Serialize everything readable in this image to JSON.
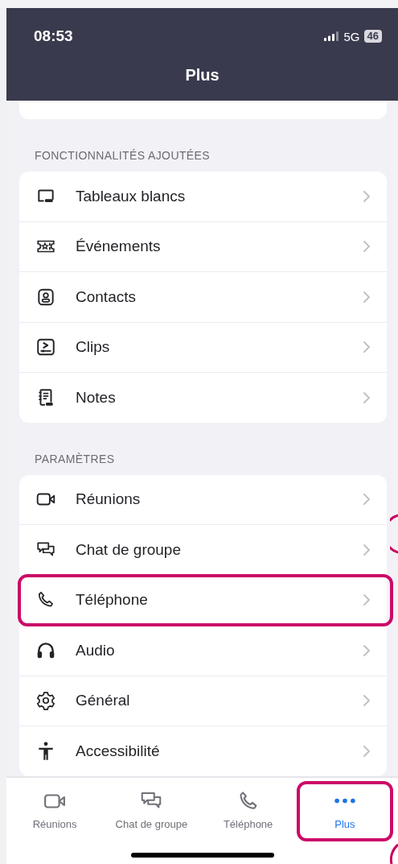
{
  "status_bar": {
    "time": "08:53",
    "network": "5G",
    "battery": "46"
  },
  "header": {
    "title": "Plus"
  },
  "sections": [
    {
      "title": "FONCTIONNALITÉS AJOUTÉES",
      "items": [
        {
          "label": "Tableaux blancs",
          "kind": "whiteboard",
          "highlighted": false
        },
        {
          "label": "Événements",
          "kind": "ticket",
          "highlighted": false
        },
        {
          "label": "Contacts",
          "kind": "contact",
          "highlighted": false
        },
        {
          "label": "Clips",
          "kind": "clip",
          "highlighted": false
        },
        {
          "label": "Notes",
          "kind": "notes",
          "highlighted": false
        }
      ]
    },
    {
      "title": "PARAMÈTRES",
      "items": [
        {
          "label": "Réunions",
          "kind": "video",
          "highlighted": false
        },
        {
          "label": "Chat de groupe",
          "kind": "chat",
          "highlighted": false
        },
        {
          "label": "Téléphone",
          "kind": "phone",
          "highlighted": true
        },
        {
          "label": "Audio",
          "kind": "headphones",
          "highlighted": false
        },
        {
          "label": "Général",
          "kind": "gear",
          "highlighted": false
        },
        {
          "label": "Accessibilité",
          "kind": "accessibility",
          "highlighted": false
        }
      ]
    }
  ],
  "tab_bar": [
    {
      "label": "Réunions",
      "kind": "video",
      "selected": false,
      "highlighted": false
    },
    {
      "label": "Chat de groupe",
      "kind": "chat",
      "selected": false,
      "highlighted": false
    },
    {
      "label": "Téléphone",
      "kind": "phone",
      "selected": false,
      "highlighted": false
    },
    {
      "label": "Plus",
      "kind": "more",
      "selected": true,
      "highlighted": true
    }
  ]
}
